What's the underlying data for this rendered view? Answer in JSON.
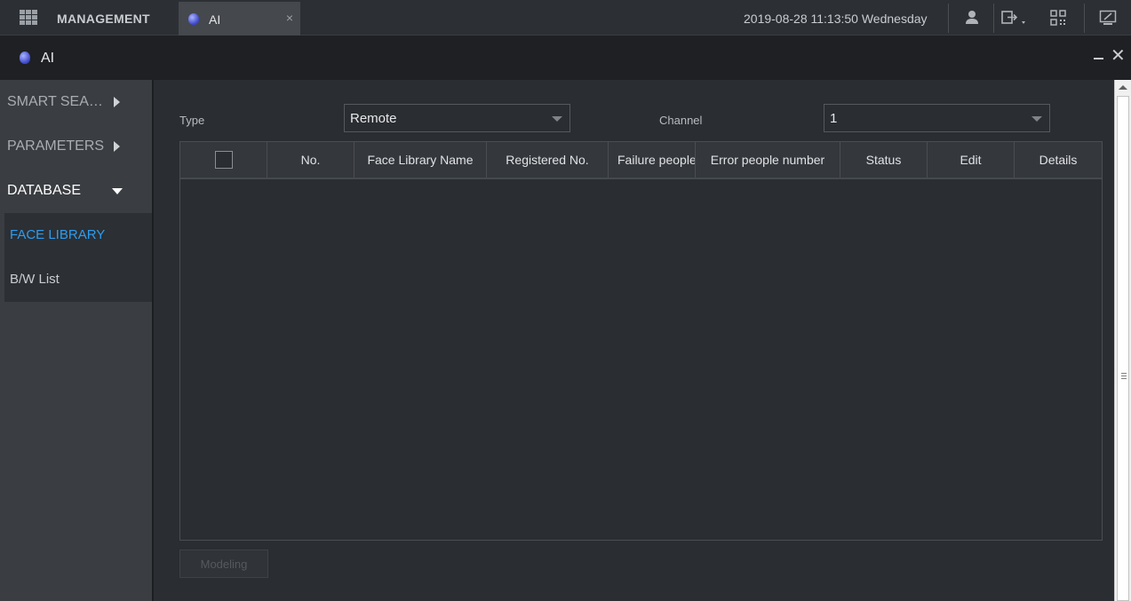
{
  "topbar": {
    "management_label": "MANAGEMENT",
    "tab_label": "AI",
    "tab_close": "×",
    "datetime": "2019-08-28 11:13:50 Wednesday",
    "icons": [
      "user-icon",
      "logout-icon",
      "qr-code-icon",
      "display-icon"
    ]
  },
  "window": {
    "title": "AI",
    "close": "✕"
  },
  "sidebar": {
    "items": [
      {
        "label": "SMART SEA…"
      },
      {
        "label": "PARAMETERS"
      },
      {
        "label": "DATABASE"
      }
    ],
    "subitems": [
      {
        "label": "FACE LIBRARY",
        "active": true,
        "color": "#2d9cf0"
      },
      {
        "label": "B/W List"
      }
    ]
  },
  "filters": {
    "type_label": "Type",
    "type_value": "Remote",
    "channel_label": "Channel",
    "channel_value": "1"
  },
  "table": {
    "columns": [
      "No.",
      "Face Library Name",
      "Registered No.",
      "Failure people",
      "Error people number",
      "Status",
      "Edit",
      "Details"
    ],
    "rows": []
  },
  "actions": {
    "modeling_label": "Modeling"
  }
}
